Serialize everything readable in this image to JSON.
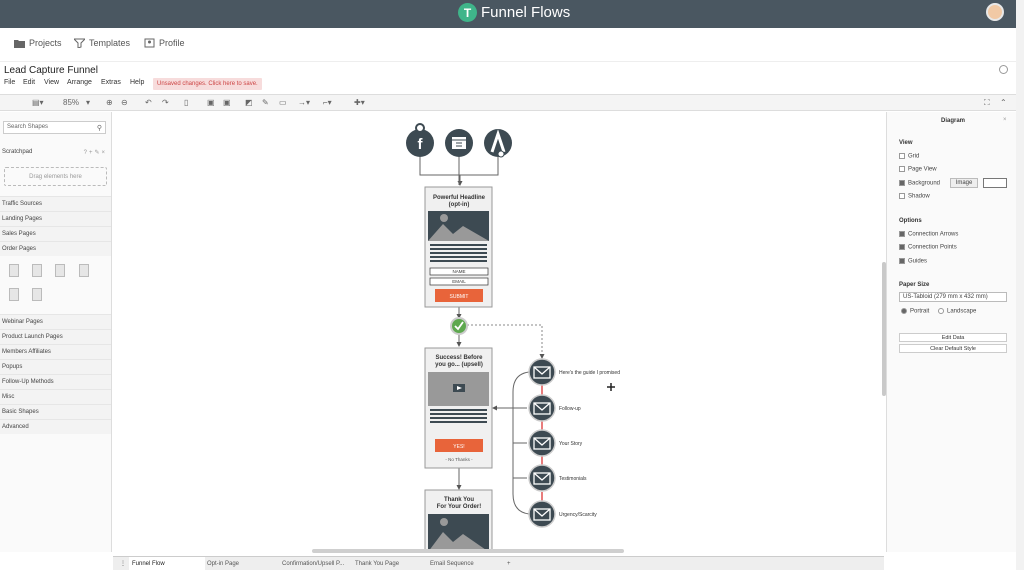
{
  "app": {
    "name": "Funnel Flows"
  },
  "nav": {
    "projects": "Projects",
    "templates": "Templates",
    "profile": "Profile"
  },
  "doc": {
    "title": "Lead Capture Funnel",
    "unsaved": "Unsaved changes. Click here to save."
  },
  "menu": [
    "File",
    "Edit",
    "View",
    "Arrange",
    "Extras",
    "Help"
  ],
  "toolbar": {
    "zoom": "85%"
  },
  "left": {
    "search_placeholder": "Search Shapes",
    "scratchpad": "Scratchpad",
    "drag_hint": "Drag elements here",
    "categories_top": [
      "Traffic Sources",
      "Landing Pages",
      "Sales Pages",
      "Order Pages"
    ],
    "categories_bottom": [
      "Webinar Pages",
      "Product Launch Pages",
      "Members Affiliates",
      "Popups",
      "Follow-Up Methods",
      "Misc",
      "Basic Shapes",
      "Advanced"
    ]
  },
  "diagram": {
    "optin": {
      "headline1": "Powerful Headline",
      "headline2": "(opt-in)",
      "name": "NAME",
      "email": "EMAIL",
      "submit": "SUBMIT"
    },
    "upsell": {
      "headline1": "Success! Before",
      "headline2": "you go... (upsell)",
      "yes": "YES!",
      "no": "- No Thanks -"
    },
    "thanks": {
      "headline1": "Thank You",
      "headline2": "For Your Order!"
    },
    "emails": [
      "Here's the guide I promised",
      "Follow-up",
      "Your Story",
      "Testimonials",
      "Urgency/Scarcity"
    ]
  },
  "right": {
    "title": "Diagram",
    "view": "View",
    "view_items": [
      {
        "label": "Grid",
        "checked": false
      },
      {
        "label": "Page View",
        "checked": false
      },
      {
        "label": "Background",
        "checked": true
      },
      {
        "label": "Shadow",
        "checked": false
      }
    ],
    "image_btn": "Image",
    "options": "Options",
    "option_items": [
      {
        "label": "Connection Arrows",
        "checked": true
      },
      {
        "label": "Connection Points",
        "checked": true
      },
      {
        "label": "Guides",
        "checked": true
      }
    ],
    "paper_size": "Paper Size",
    "paper_value": "US-Tabloid (279 mm x 432 mm)",
    "portrait": "Portrait",
    "landscape": "Landscape",
    "edit_data": "Edit Data",
    "clear_style": "Clear Default Style"
  },
  "tabs": [
    "Funnel Flow",
    "Opt-in Page",
    "Confirmation/Upsell P...",
    "Thank You Page",
    "Email Sequence"
  ],
  "colors": {
    "topbar": "#4a5761",
    "accent": "#3fb58a",
    "button": "#e8643a",
    "node": "#3d4a52"
  }
}
